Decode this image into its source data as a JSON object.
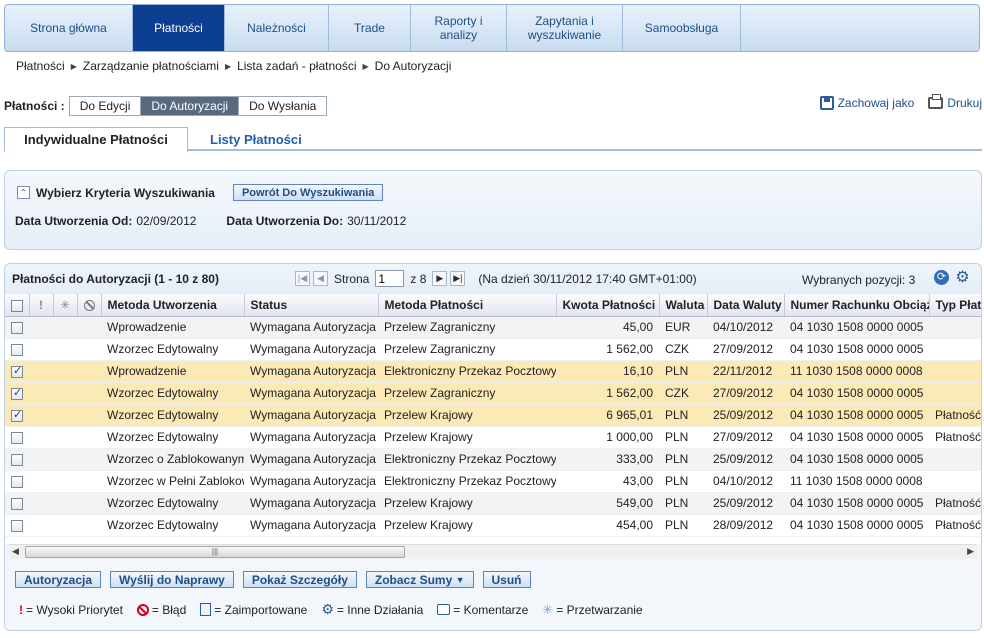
{
  "nav": {
    "items": [
      {
        "label": "Strona główna"
      },
      {
        "label": "Płatności"
      },
      {
        "label": "Należności"
      },
      {
        "label": "Trade"
      },
      {
        "label": "Raporty i\nanalizy"
      },
      {
        "label": "Zapytania i\nwyszukiwanie"
      },
      {
        "label": "Samoobsługa"
      }
    ],
    "active_index": 1
  },
  "breadcrumb": [
    "Płatności",
    "Zarządzanie płatnościami",
    "Lista zadań - płatności",
    "Do Autoryzacji"
  ],
  "status_filter": {
    "label": "Płatności :",
    "options": [
      "Do Edycji",
      "Do Autoryzacji",
      "Do Wysłania"
    ],
    "selected": "Do Autoryzacji"
  },
  "top_actions": {
    "save_as": "Zachowaj jako",
    "print": "Drukuj"
  },
  "tabs": [
    "Indywidualne Płatności",
    "Listy Płatności"
  ],
  "criteria": {
    "title": "Wybierz Kryteria Wyszukiwania",
    "back_button": "Powrót Do Wyszukiwania",
    "date_from_label": "Data Utworzenia Od:",
    "date_from": "02/09/2012",
    "date_to_label": "Data Utworzenia Do:",
    "date_to": "30/11/2012"
  },
  "grid": {
    "title": "Płatności do Autoryzacji (1 - 10 z 80)",
    "page_label": "Strona",
    "page_value": "1",
    "page_of": "z 8",
    "as_of": "(Na dzień 30/11/2012 17:40 GMT+01:00)",
    "selected_count": "Wybranych pozycji: 3",
    "columns": [
      "Metoda Utworzenia",
      "Status",
      "Metoda Płatności",
      "Kwota Płatności",
      "Waluta",
      "Data Waluty",
      "Numer Rachunku Obciążanego",
      "Typ Płatności"
    ],
    "rows": [
      {
        "checked": false,
        "method": "Wprowadzenie",
        "status": "Wymagana Autoryzacja",
        "payment": "Przelew Zagraniczny",
        "amount": "45,00",
        "currency": "EUR",
        "date": "04/10/2012",
        "account": "04 1030 1508 0000 0005",
        "type": ""
      },
      {
        "checked": false,
        "method": "Wzorzec Edytowalny",
        "status": "Wymagana Autoryzacja",
        "payment": "Przelew Zagraniczny",
        "amount": "1 562,00",
        "currency": "CZK",
        "date": "27/09/2012",
        "account": "04 1030 1508 0000 0005",
        "type": ""
      },
      {
        "checked": true,
        "method": "Wprowadzenie",
        "status": "Wymagana Autoryzacja",
        "payment": "Elektroniczny Przekaz Pocztowy",
        "amount": "16,10",
        "currency": "PLN",
        "date": "22/11/2012",
        "account": "11 1030 1508 0000 0008",
        "type": ""
      },
      {
        "checked": true,
        "method": "Wzorzec Edytowalny",
        "status": "Wymagana Autoryzacja",
        "payment": "Przelew Zagraniczny",
        "amount": "1 562,00",
        "currency": "CZK",
        "date": "27/09/2012",
        "account": "04 1030 1508 0000 0005",
        "type": ""
      },
      {
        "checked": true,
        "method": "Wzorzec Edytowalny",
        "status": "Wymagana Autoryzacja",
        "payment": "Przelew Krajowy",
        "amount": "6 965,01",
        "currency": "PLN",
        "date": "25/09/2012",
        "account": "04 1030 1508 0000 0005",
        "type": "Płatność"
      },
      {
        "checked": false,
        "method": "Wzorzec Edytowalny",
        "status": "Wymagana Autoryzacja",
        "payment": "Przelew Krajowy",
        "amount": "1 000,00",
        "currency": "PLN",
        "date": "27/09/2012",
        "account": "04 1030 1508 0000 0005",
        "type": "Płatność"
      },
      {
        "checked": false,
        "method": "Wzorzec o Zablokowanym",
        "status": "Wymagana Autoryzacja",
        "payment": "Elektroniczny Przekaz Pocztowy",
        "amount": "333,00",
        "currency": "PLN",
        "date": "25/09/2012",
        "account": "04 1030 1508 0000 0005",
        "type": ""
      },
      {
        "checked": false,
        "method": "Wzorzec w Pełni Zablokowany",
        "status": "Wymagana Autoryzacja",
        "payment": "Elektroniczny Przekaz Pocztowy",
        "amount": "43,00",
        "currency": "PLN",
        "date": "04/10/2012",
        "account": "11 1030 1508 0000 0008",
        "type": ""
      },
      {
        "checked": false,
        "method": "Wzorzec Edytowalny",
        "status": "Wymagana Autoryzacja",
        "payment": "Przelew Krajowy",
        "amount": "549,00",
        "currency": "PLN",
        "date": "25/09/2012",
        "account": "04 1030 1508 0000 0005",
        "type": "Płatność"
      },
      {
        "checked": false,
        "method": "Wzorzec Edytowalny",
        "status": "Wymagana Autoryzacja",
        "payment": "Przelew Krajowy",
        "amount": "454,00",
        "currency": "PLN",
        "date": "28/09/2012",
        "account": "04 1030 1508 0000 0005",
        "type": "Płatność"
      }
    ]
  },
  "buttons": {
    "authorize": "Autoryzacja",
    "send_for_repair": "Wyślij do Naprawy",
    "show_details": "Pokaż Szczegóły",
    "view_totals": "Zobacz Sumy",
    "delete": "Usuń"
  },
  "legend": {
    "high_priority": "= Wysoki Priorytet",
    "error": "= Błąd",
    "imported": "= Zaimportowane",
    "other_actions": "= Inne Działania",
    "comments": "= Komentarze",
    "processing": "= Przetwarzanie"
  },
  "colors": {
    "nav_active": "#0c3f91",
    "selected_row": "#fbe9b6",
    "link": "#1e5fb0"
  }
}
